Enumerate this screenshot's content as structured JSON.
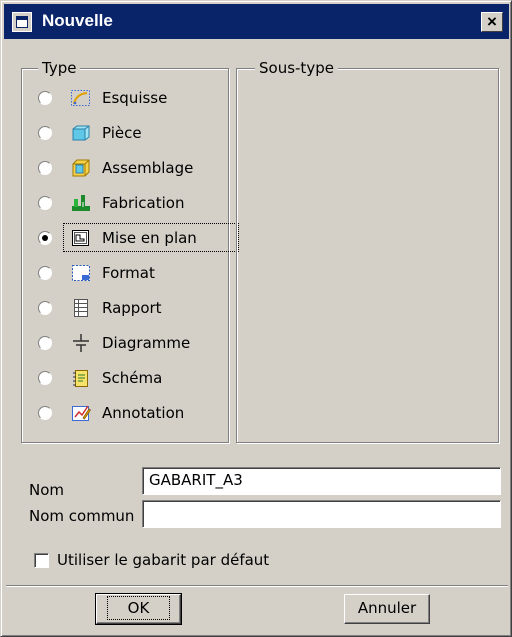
{
  "window": {
    "title": "Nouvelle",
    "close_label": "×"
  },
  "type_group": {
    "label": "Type",
    "items": [
      {
        "label": "Esquisse",
        "icon": "sketch-icon",
        "selected": false
      },
      {
        "label": "Pièce",
        "icon": "part-icon",
        "selected": false
      },
      {
        "label": "Assemblage",
        "icon": "assembly-icon",
        "selected": false
      },
      {
        "label": "Fabrication",
        "icon": "manufacturing-icon",
        "selected": false
      },
      {
        "label": "Mise en plan",
        "icon": "drawing-icon",
        "selected": true
      },
      {
        "label": "Format",
        "icon": "format-icon",
        "selected": false
      },
      {
        "label": "Rapport",
        "icon": "report-icon",
        "selected": false
      },
      {
        "label": "Diagramme",
        "icon": "diagram-icon",
        "selected": false
      },
      {
        "label": "Schéma",
        "icon": "schema-icon",
        "selected": false
      },
      {
        "label": "Annotation",
        "icon": "annotation-icon",
        "selected": false
      }
    ]
  },
  "subtype_group": {
    "label": "Sous-type"
  },
  "fields": {
    "name_label": "Nom",
    "name_value": "GABARIT_A3",
    "common_name_label": "Nom commun",
    "common_name_value": ""
  },
  "options": {
    "use_default_template_label": "Utiliser le gabarit par défaut",
    "use_default_template_checked": false
  },
  "buttons": {
    "ok_label": "OK",
    "cancel_label": "Annuler"
  },
  "colors": {
    "title_bar": "#0a246a",
    "face": "#d4d0c8"
  }
}
